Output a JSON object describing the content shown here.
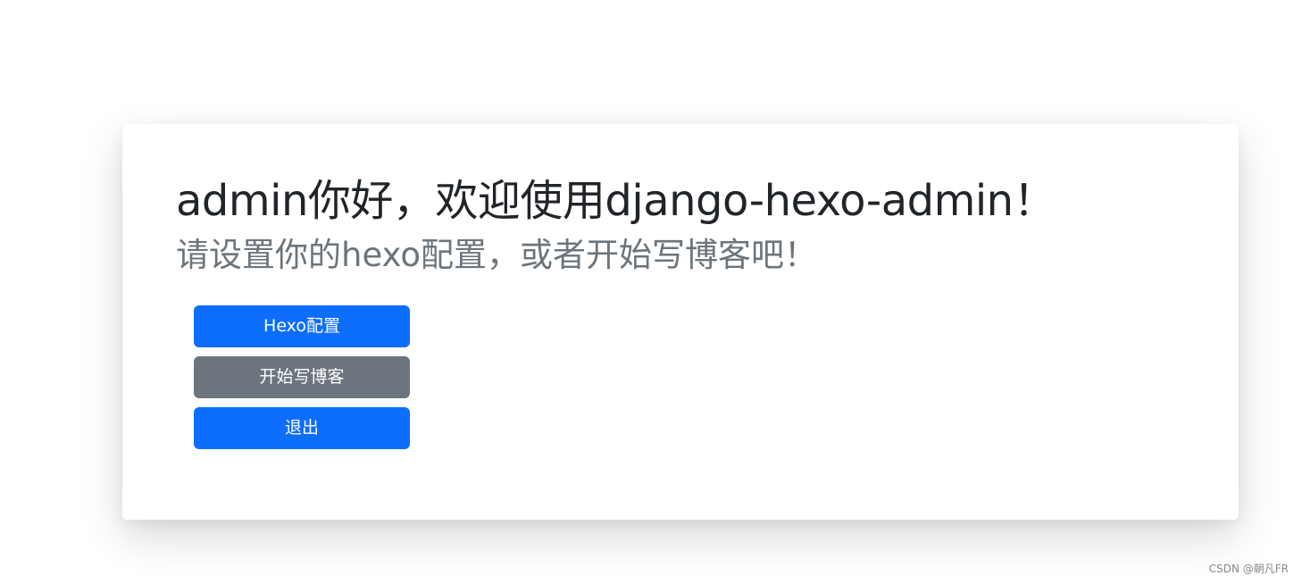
{
  "main": {
    "greeting": "admin你好，欢迎使用django-hexo-admin！",
    "subtitle": "请设置你的hexo配置，或者开始写博客吧！",
    "buttons": {
      "hexo_config": "Hexo配置",
      "start_writing": "开始写博客",
      "logout": "退出"
    }
  },
  "watermark": "CSDN @朝凡FR",
  "colors": {
    "primary": "#0d6efd",
    "secondary": "#6c757d",
    "heading_text": "#212529",
    "muted_text": "#6c757d"
  }
}
